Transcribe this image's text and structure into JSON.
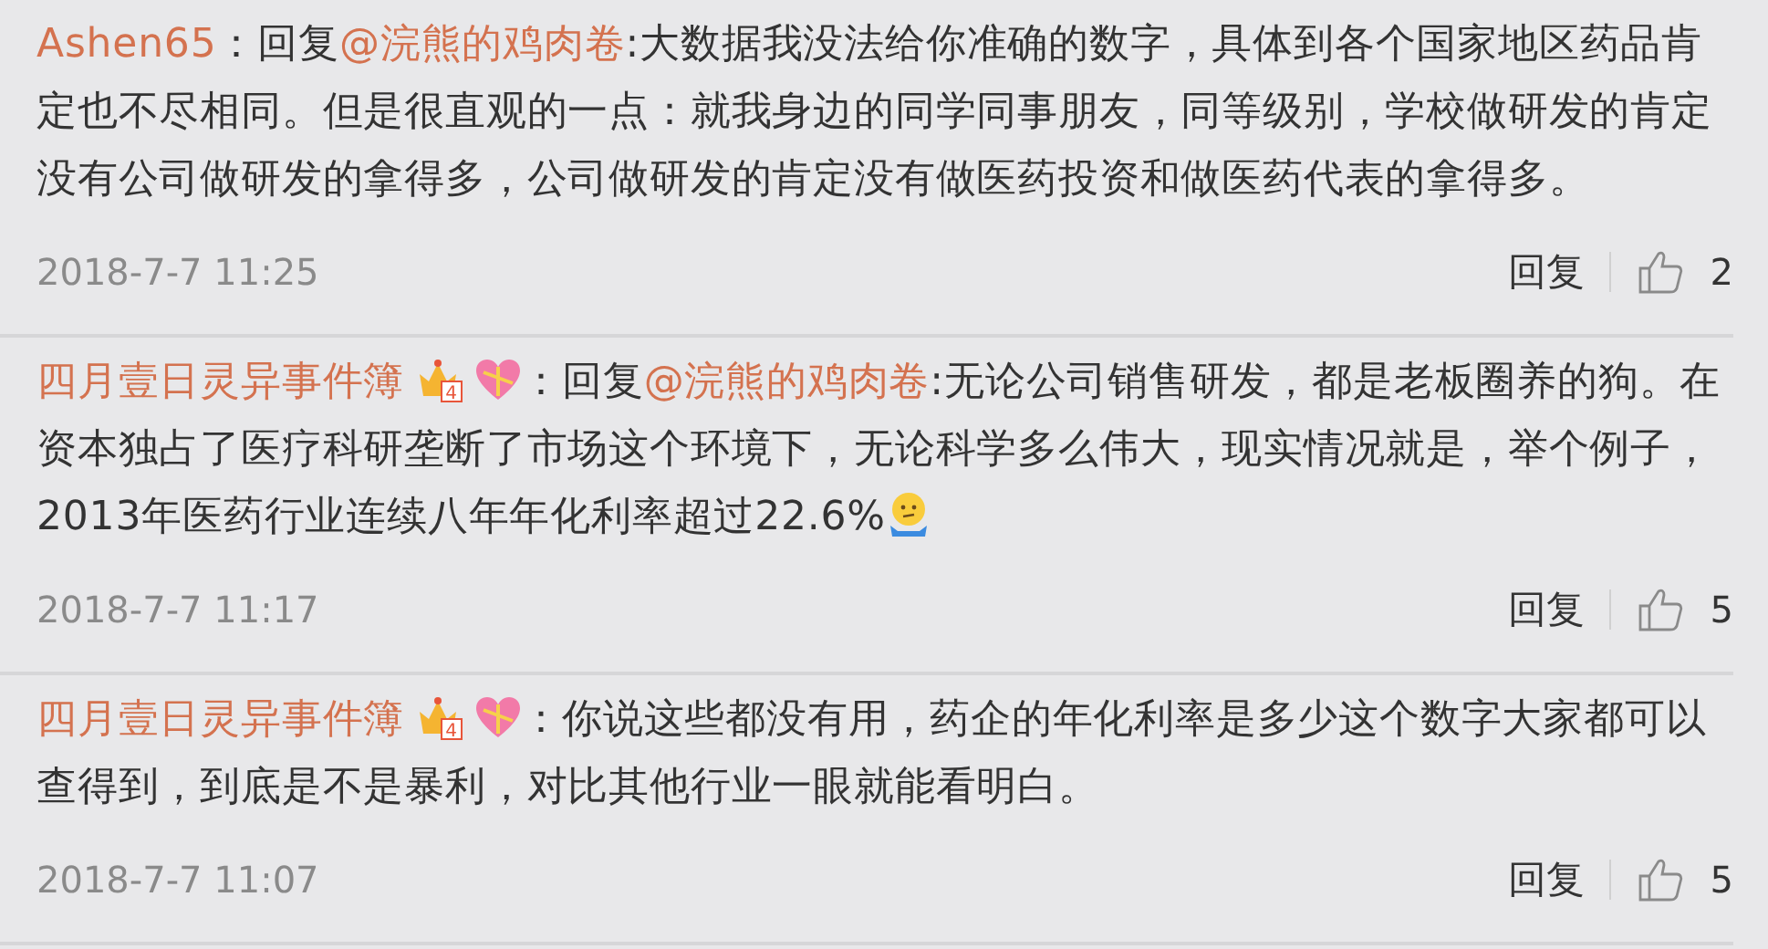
{
  "comments": [
    {
      "user": "Ashen65",
      "separator": "：",
      "reply_label": "回复",
      "reply_to": "@浣熊的鸡肉卷",
      "text": ":大数据我没法给你准确的数字，具体到各个国家地区药品肯定也不尽相同。但是很直观的一点：就我身边的同学同事朋友，同等级别，学校做研发的肯定没有公司做研发的拿得多，公司做研发的肯定没有做医药投资和做医药代表的拿得多。",
      "trailing_emoji": false,
      "time": "2018-7-7 11:25",
      "reply_button": "回复",
      "likes": "2"
    },
    {
      "user": "四月壹日灵异事件簿",
      "badges": [
        {
          "kind": "crown",
          "text": "4"
        },
        {
          "kind": "heart"
        }
      ],
      "separator": "：",
      "reply_label": "回复",
      "reply_to": "@浣熊的鸡肉卷",
      "text": ":无论公司销售研发，都是老板圈养的狗。在资本独占了医疗科研垄断了市场这个环境下，无论科学多么伟大，现实情况就是，举个例子，2013年医药行业连续八年年化利率超过22.6%",
      "trailing_emoji": true,
      "time": "2018-7-7 11:17",
      "reply_button": "回复",
      "likes": "5"
    },
    {
      "user": "四月壹日灵异事件簿",
      "badges": [
        {
          "kind": "crown",
          "text": "4"
        },
        {
          "kind": "heart"
        }
      ],
      "separator": "：",
      "text": "你说这些都没有用，药企的年化利率是多少这个数字大家都可以查得到，到底是不是暴利，对比其他行业一眼就能看明白。",
      "trailing_emoji": false,
      "time": "2018-7-7 11:07",
      "reply_button": "回复",
      "likes": "5"
    }
  ]
}
